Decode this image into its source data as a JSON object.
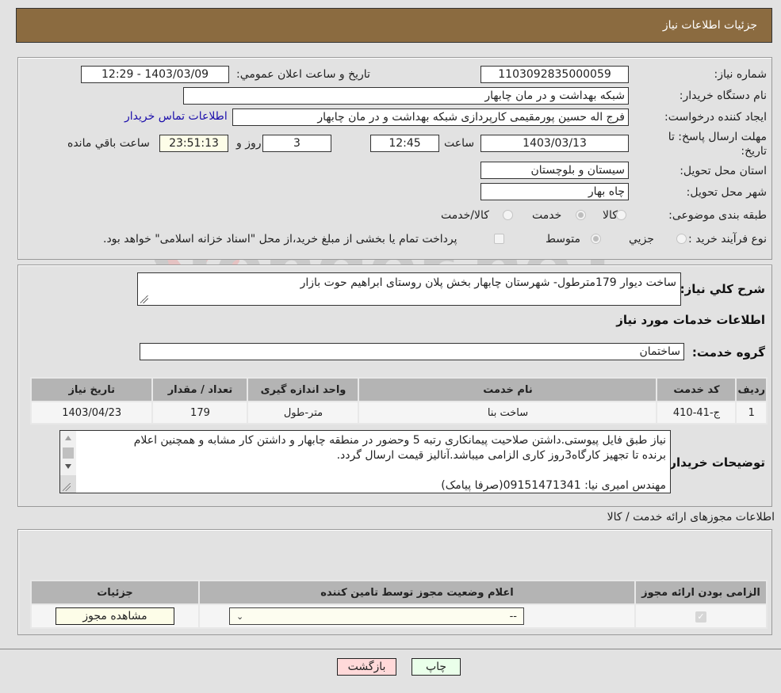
{
  "header": {
    "title": "جزئیات اطلاعات نیاز"
  },
  "form": {
    "need_number_label": "شماره نیاز:",
    "need_number": "1103092835000059",
    "announce_label": "تاریخ و ساعت اعلان عمومي:",
    "announce_value": "1403/03/09 - 12:29",
    "buyer_org_label": "نام دستگاه خریدار:",
    "buyer_org": "شبکه بهداشت و در مان چابهار",
    "creator_label": "ایجاد کننده درخواست:",
    "creator": "فرج اله حسین پورمقیمی کارپردازی شبکه بهداشت و در مان چابهار",
    "contact_link": "اطلاعات تماس خریدار",
    "deadline_label": "مهلت ارسال پاسخ: تا تاریخ:",
    "deadline_date": "1403/03/13",
    "time_label": "ساعت",
    "deadline_time": "12:45",
    "days_value": "3",
    "days_label": "روز و",
    "remaining_time": "23:51:13",
    "remaining_label": "ساعت باقي مانده",
    "province_label": "استان محل تحویل:",
    "province": "سیستان و بلوچستان",
    "city_label": "شهر محل تحویل:",
    "city": "چاه بهار",
    "category_label": "طبقه بندی موضوعی:",
    "category_options": [
      {
        "label": "کالا",
        "selected": false
      },
      {
        "label": "خدمت",
        "selected": true
      },
      {
        "label": "کالا/خدمت",
        "selected": false
      }
    ],
    "process_label": "نوع فرآیند خرید :",
    "process_options": [
      {
        "label": "جزيي",
        "selected": false
      },
      {
        "label": "متوسط",
        "selected": true
      }
    ],
    "treasury_checked": false,
    "treasury_text": "پرداخت تمام یا بخشی از مبلغ خرید،از محل \"اسناد خزانه اسلامی\" خواهد بود."
  },
  "description": {
    "label": "شرح کلي نیاز:",
    "value": "ساخت دیوار 179مترطول- شهرستان چابهار بخش پلان روستای ابراهیم حوت بازار"
  },
  "services": {
    "section_title": "اطلاعات خدمات مورد نیاز",
    "group_label": "گروه خدمت:",
    "group_value": "ساختمان",
    "columns": [
      "ردیف",
      "کد خدمت",
      "نام خدمت",
      "واحد اندازه گیری",
      "تعداد / مقدار",
      "تاریخ نیاز"
    ],
    "rows": [
      [
        "1",
        "ج-41-410",
        "ساخت بنا",
        "متر-طول",
        "179",
        "1403/04/23"
      ]
    ]
  },
  "buyer_notes": {
    "label": "توضیحات خریدار:",
    "lines": [
      "نیاز طبق فایل پیوستی.داشتن صلاحیت پیمانکاری رتبه 5 وحضور در منطقه چابهار و داشتن کار مشابه و همچنین اعلام",
      "برنده تا تجهیز کارگاه3روز کاری الزامی میباشد.آنالیز قیمت ارسال گردد.",
      "",
      "مهندس امیری نیا: 09151471341(صرفا پیامک)"
    ]
  },
  "licenses": {
    "section_title": "اطلاعات مجوزهای ارائه خدمت / کالا",
    "columns": [
      "الزامی بودن ارائه مجوز",
      "اعلام وضعیت مجوز توسط تامین کننده",
      "جزئیات"
    ],
    "rows": [
      {
        "required": true,
        "status_value": "--",
        "details_button": "مشاهده مجوز"
      }
    ]
  },
  "footer": {
    "print_button": "چاپ",
    "back_button": "بازگشت"
  },
  "watermark": {
    "text": "AriaTender.neT"
  },
  "colors": {
    "header_bg": "#8b6b40",
    "back_button_bg": "#ffd9d9",
    "print_button_bg": "#eaffea",
    "highlight_field_bg": "#fdfde8",
    "link": "#1a0dab"
  }
}
